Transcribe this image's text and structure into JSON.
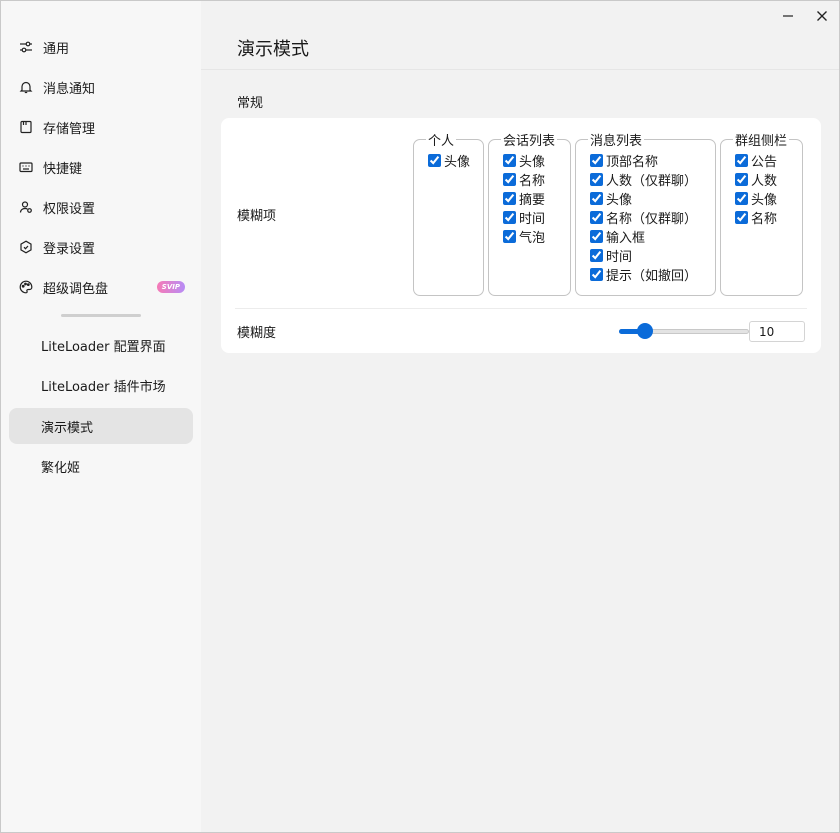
{
  "window_controls": {
    "minimize": "minimize",
    "close": "close"
  },
  "sidebar": {
    "items": [
      {
        "label": "通用",
        "icon": "sliders-icon"
      },
      {
        "label": "消息通知",
        "icon": "bell-icon"
      },
      {
        "label": "存储管理",
        "icon": "storage-icon"
      },
      {
        "label": "快捷键",
        "icon": "keyboard-icon"
      },
      {
        "label": "权限设置",
        "icon": "user-permission-icon"
      },
      {
        "label": "登录设置",
        "icon": "hexagon-icon"
      },
      {
        "label": "超级调色盘",
        "icon": "palette-icon",
        "badge": "SVIP"
      }
    ],
    "plugins": [
      {
        "label": "LiteLoader 配置界面"
      },
      {
        "label": "LiteLoader 插件市场"
      },
      {
        "label": "演示模式",
        "active": true
      },
      {
        "label": "繁化姬"
      }
    ]
  },
  "main": {
    "title": "演示模式",
    "section_title": "常规",
    "blur_items": {
      "label": "模糊项",
      "groups": [
        {
          "legend": "个人",
          "options": [
            {
              "label": "头像",
              "checked": true
            }
          ]
        },
        {
          "legend": "会话列表",
          "options": [
            {
              "label": "头像",
              "checked": true
            },
            {
              "label": "名称",
              "checked": true
            },
            {
              "label": "摘要",
              "checked": true
            },
            {
              "label": "时间",
              "checked": true
            },
            {
              "label": "气泡",
              "checked": true
            }
          ]
        },
        {
          "legend": "消息列表",
          "options": [
            {
              "label": "顶部名称",
              "checked": true
            },
            {
              "label": "人数（仅群聊）",
              "checked": true
            },
            {
              "label": "头像",
              "checked": true
            },
            {
              "label": "名称（仅群聊）",
              "checked": true
            },
            {
              "label": "输入框",
              "checked": true
            },
            {
              "label": "时间",
              "checked": true
            },
            {
              "label": "提示（如撤回）",
              "checked": true
            }
          ]
        },
        {
          "legend": "群组侧栏",
          "options": [
            {
              "label": "公告",
              "checked": true
            },
            {
              "label": "人数",
              "checked": true
            },
            {
              "label": "头像",
              "checked": true
            },
            {
              "label": "名称",
              "checked": true
            }
          ]
        }
      ]
    },
    "blur_level": {
      "label": "模糊度",
      "value": "10",
      "slider_fraction": 0.2
    }
  },
  "colors": {
    "accent": "#0b6bd9",
    "active_bg": "#e4e4e4",
    "card_bg": "#ffffff",
    "page_bg": "#f2f2f2"
  }
}
